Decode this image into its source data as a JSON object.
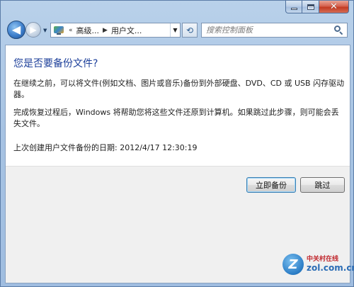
{
  "window": {
    "caption_buttons": {
      "minimize_icon": "minimize-icon",
      "maximize_icon": "maximize-icon",
      "close_glyph": "✕"
    }
  },
  "navigation": {
    "back_glyph": "◀",
    "forward_glyph": "▶",
    "history_glyph": "▼",
    "address": {
      "overflow_glyph": "«",
      "segments": [
        "高级...",
        "用户文..."
      ],
      "separator_glyph": "▶",
      "dropdown_glyph": "▼"
    },
    "refresh_glyph": "⟲",
    "search": {
      "placeholder": "搜索控制面板",
      "value": ""
    }
  },
  "content": {
    "title": "您是否要备份文件?",
    "paragraph1": "在继续之前，可以将文件(例如文档、图片或音乐)备份到外部硬盘、DVD、CD 或 USB 闪存驱动器。",
    "paragraph2": "完成恢复过程后，Windows 将帮助您将这些文件还原到计算机。如果跳过此步骤，则可能会丢失文件。",
    "last_backup": "上次创建用户文件备份的日期: 2012/4/17 12:30:19"
  },
  "buttons": {
    "backup_now": "立即备份",
    "skip": "跳过"
  },
  "watermark": {
    "logo_letter": "Z",
    "chinese": "中关村在线",
    "domain": "zol.com.cn"
  },
  "colors": {
    "title_blue": "#1c3f9a",
    "chrome_blue": "#a7c3e3",
    "close_red": "#c23b23"
  }
}
